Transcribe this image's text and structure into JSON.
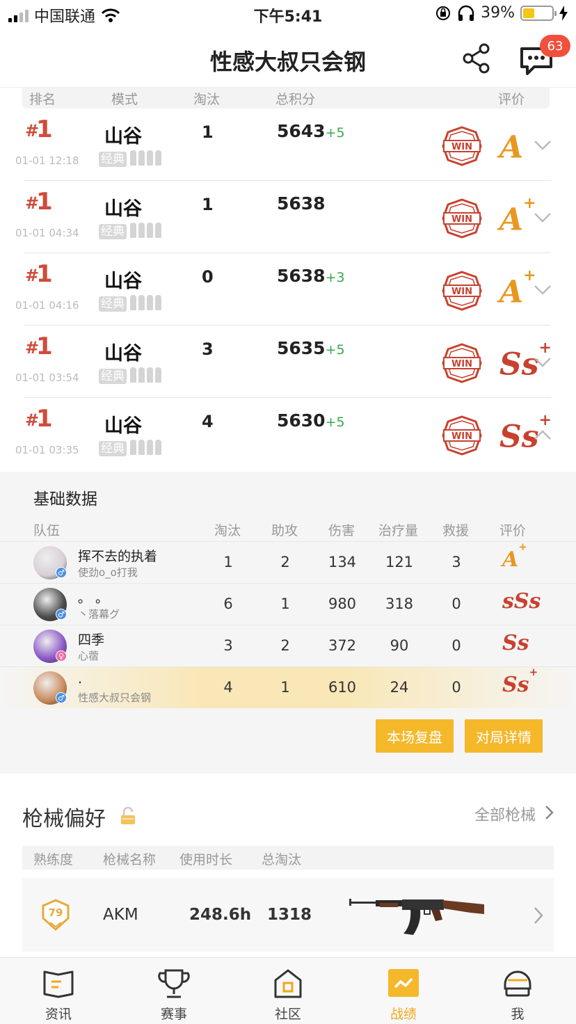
{
  "status_bar": {
    "carrier": "中国联通",
    "time": "下午5:41",
    "battery": "39%",
    "battery_level": 0.39
  },
  "nav": {
    "title": "性感大叔只会钢",
    "message_badge": "63"
  },
  "history_header": {
    "rank": "排名",
    "mode": "模式",
    "kills": "淘汰",
    "score": "总积分",
    "rating": "评价"
  },
  "matches": [
    {
      "rank_hash": "#",
      "rank": "1",
      "time": "01-01 12:18",
      "mode": "山谷",
      "mode_tag": "经典",
      "kills": "1",
      "score": "5643",
      "delta": "+5",
      "grade": "A",
      "grade_sup": "",
      "grade_color": "#e8971f",
      "expanded": false
    },
    {
      "rank_hash": "#",
      "rank": "1",
      "time": "01-01 04:34",
      "mode": "山谷",
      "mode_tag": "经典",
      "kills": "1",
      "score": "5638",
      "delta": "",
      "grade": "A",
      "grade_sup": "+",
      "grade_color": "#e8971f",
      "expanded": false
    },
    {
      "rank_hash": "#",
      "rank": "1",
      "time": "01-01 04:16",
      "mode": "山谷",
      "mode_tag": "经典",
      "kills": "0",
      "score": "5638",
      "delta": "+3",
      "grade": "A",
      "grade_sup": "+",
      "grade_color": "#e8971f",
      "expanded": false
    },
    {
      "rank_hash": "#",
      "rank": "1",
      "time": "01-01 03:54",
      "mode": "山谷",
      "mode_tag": "经典",
      "kills": "3",
      "score": "5635",
      "delta": "+5",
      "grade": "Ss",
      "grade_sup": "+",
      "grade_color": "#c8412f",
      "expanded": false
    },
    {
      "rank_hash": "#",
      "rank": "1",
      "time": "01-01 03:35",
      "mode": "山谷",
      "mode_tag": "经典",
      "kills": "4",
      "score": "5630",
      "delta": "+5",
      "grade": "Ss",
      "grade_sup": "+",
      "grade_color": "#c8412f",
      "expanded": true
    }
  ],
  "detail": {
    "title": "基础数据",
    "headers": {
      "team": "队伍",
      "kills": "淘汰",
      "assists": "助攻",
      "damage": "伤害",
      "healing": "治疗量",
      "revives": "救援",
      "rating": "评价"
    },
    "players": [
      {
        "name": "挥不去的执着",
        "sub": "使劲o_o打我",
        "gender": "♂",
        "gender_color": "#4a90e2",
        "kills": "1",
        "assists": "2",
        "damage": "134",
        "healing": "121",
        "revives": "3",
        "grade": "A",
        "grade_sup": "+",
        "grade_color": "#e8971f",
        "avatar_color": "#d9cfd6"
      },
      {
        "name": "。 。",
        "sub": "丶落幕グ",
        "gender": "♂",
        "gender_color": "#4a90e2",
        "kills": "6",
        "assists": "1",
        "damage": "980",
        "healing": "318",
        "revives": "0",
        "grade": "sSs",
        "grade_sup": "",
        "grade_color": "#c8412f",
        "avatar_color": "#4a4a4a"
      },
      {
        "name": "四季",
        "sub": "心蓿",
        "gender": "♀",
        "gender_color": "#f06aa5",
        "kills": "3",
        "assists": "2",
        "damage": "372",
        "healing": "90",
        "revives": "0",
        "grade": "Ss",
        "grade_sup": "",
        "grade_color": "#c8412f",
        "avatar_color": "#8a55c8"
      },
      {
        "name": ".",
        "sub": "性感大叔只会钢",
        "gender": "♂",
        "gender_color": "#4a90e2",
        "kills": "4",
        "assists": "1",
        "damage": "610",
        "healing": "24",
        "revives": "0",
        "grade": "Ss",
        "grade_sup": "+",
        "grade_color": "#c8412f",
        "avatar_color": "#c98a5a"
      }
    ],
    "replay_label": "本场复盘",
    "details_label": "对局详情"
  },
  "guns": {
    "title": "枪械偏好",
    "all_label": "全部枪械",
    "headers": {
      "proficiency": "熟练度",
      "name": "枪械名称",
      "duration": "使用时长",
      "kills": "总淘汰"
    },
    "items": [
      {
        "level": "79",
        "name": "AKM",
        "duration": "248.6h",
        "kills": "1318"
      }
    ]
  },
  "tabs": [
    {
      "label": "资讯",
      "icon": "news-icon"
    },
    {
      "label": "赛事",
      "icon": "trophy-icon"
    },
    {
      "label": "社区",
      "icon": "community-icon"
    },
    {
      "label": "战绩",
      "icon": "stats-icon",
      "active": true
    },
    {
      "label": "我",
      "icon": "helmet-icon"
    }
  ]
}
